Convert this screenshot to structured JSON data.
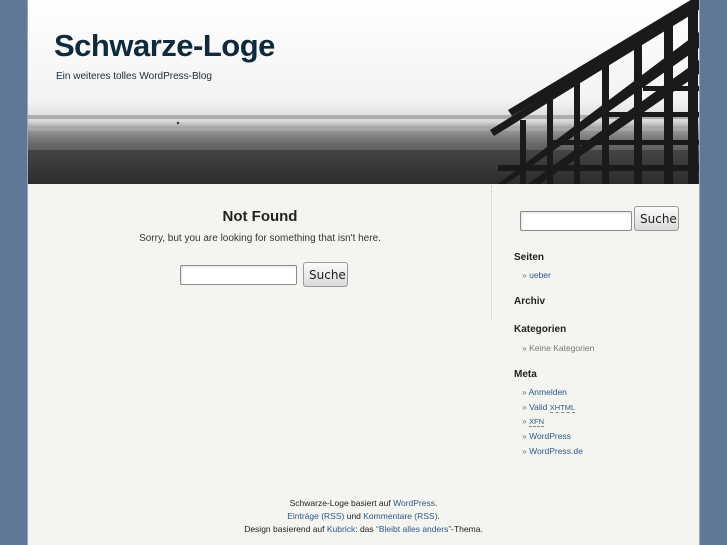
{
  "header": {
    "title": "Schwarze-Loge",
    "description": "Ein weiteres tolles WordPress-Blog"
  },
  "content": {
    "heading": "Not Found",
    "message": "Sorry, but you are looking for something that isn't here.",
    "search_button": "Suche"
  },
  "sidebar": {
    "search_button": "Suche",
    "sections": {
      "pages": {
        "heading": "Seiten",
        "items": [
          "ueber"
        ]
      },
      "archive": {
        "heading": "Archiv"
      },
      "categories": {
        "heading": "Kategorien",
        "items": [
          "Keine Kategorien"
        ]
      },
      "meta": {
        "heading": "Meta",
        "login": "Anmelden",
        "valid_prefix": "Valid ",
        "valid_abbr": "XHTML",
        "xfn": "XFN",
        "wordpress": "WordPress",
        "wordpress_de": "WordPress.de"
      }
    }
  },
  "footer": {
    "line1_prefix": "Schwarze-Loge basiert auf ",
    "line1_link": "WordPress",
    "line1_suffix": ".",
    "entries_link": "Einträge (RSS)",
    "and": " und ",
    "comments_link": "Kommentare (RSS)",
    "line2_suffix": ".",
    "line3_prefix": "Design basierend auf ",
    "kubrick_link": "Kubrick",
    "line3_mid": ": das ",
    "theme_link": "“Bleibt alles anders”",
    "line3_suffix": "-Thema."
  },
  "colors": {
    "background": "#5f7898",
    "page": "#f4f4f1",
    "title": "#0e2a3d",
    "link": "#2b5a8a"
  }
}
